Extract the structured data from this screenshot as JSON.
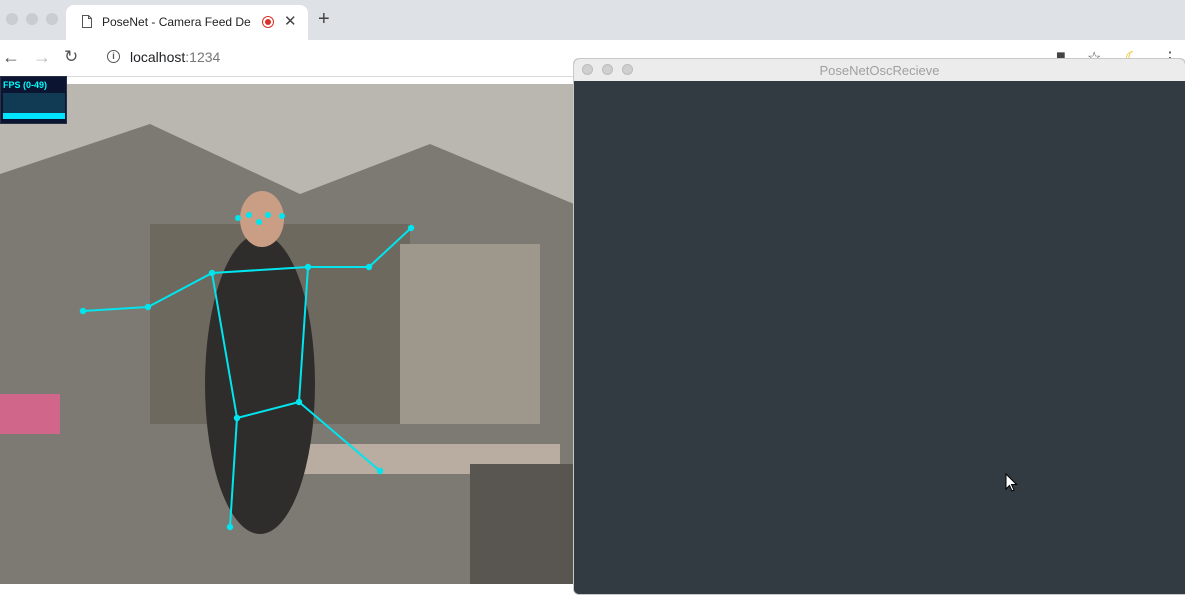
{
  "browser": {
    "tab": {
      "title": "PoseNet - Camera Feed De"
    },
    "new_tab": "+",
    "close": "✕",
    "url": {
      "host": "localhost",
      "port": ":1234"
    }
  },
  "stats_panel": {
    "label": "FPS (0-49)"
  },
  "app_window": {
    "title": "PoseNetOscRecieve",
    "background": "#333b42"
  },
  "pose_overlay": {
    "color": "#00e5ee",
    "icon": "skeleton-overlay"
  }
}
